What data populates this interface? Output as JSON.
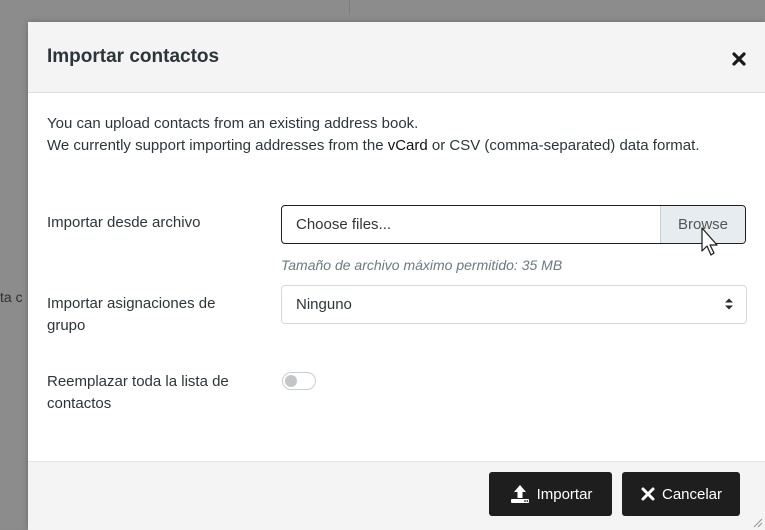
{
  "background": {
    "partial_text": "ta c"
  },
  "dialog": {
    "title": "Importar contactos",
    "intro": {
      "line1": "You can upload contacts from an existing address book.",
      "line2_before": "We currently support importing addresses from the ",
      "line2_vcard": "vCard",
      "line2_after": " or CSV (comma-separated) data format."
    },
    "file": {
      "label": "Importar desde archivo",
      "placeholder": "Choose files...",
      "browse_label": "Browse",
      "hint": "Tamaño de archivo máximo permitido: 35 MB"
    },
    "group": {
      "label": "Importar asignaciones de grupo",
      "value": "Ninguno"
    },
    "replace": {
      "label": "Reemplazar toda la lista de contactos",
      "enabled": false
    },
    "footer": {
      "import_label": "Importar",
      "cancel_label": "Cancelar"
    }
  },
  "colors": {
    "button_bg": "#1e1e1e",
    "header_bg": "#f4f4f4",
    "overlay": "#8c8c8c"
  }
}
